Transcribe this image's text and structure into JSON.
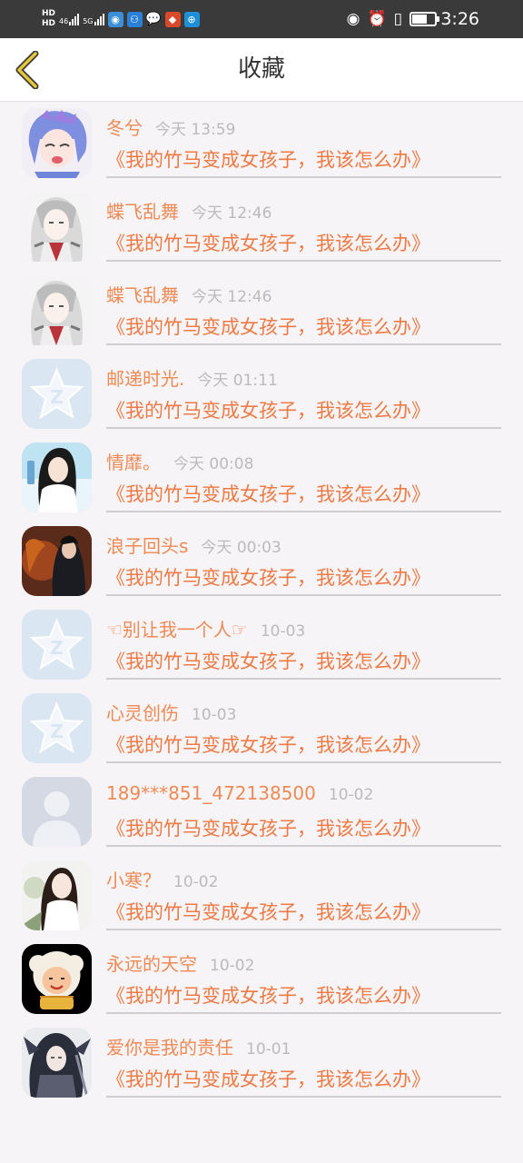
{
  "status_bar": {
    "hd1": "HD",
    "hd2": "HD",
    "net1": "46",
    "net2": "5G",
    "time": "3:26"
  },
  "header": {
    "title": "收藏"
  },
  "colors": {
    "accent": "#ee7a45",
    "name": "#ee8a55",
    "timestamp": "#bbbbbb",
    "back_arrow": "#e6c73a"
  },
  "favorites": [
    {
      "name": "冬兮",
      "time": "今天 13:59",
      "book": "《我的竹马变成女孩子，我该怎么办》",
      "avatar": "anime-blue-hair"
    },
    {
      "name": "蝶飞乱舞",
      "time": "今天 12:46",
      "book": "《我的竹马变成女孩子，我该怎么办》",
      "avatar": "anime-white-hair"
    },
    {
      "name": "蝶飞乱舞",
      "time": "今天 12:46",
      "book": "《我的竹马变成女孩子，我该怎么办》",
      "avatar": "anime-white-hair"
    },
    {
      "name": "邮递时光.",
      "time": "今天 01:11",
      "book": "《我的竹马变成女孩子，我该怎么办》",
      "avatar": "qzone-default"
    },
    {
      "name": "情靡。",
      "time": "今天 00:08",
      "book": "《我的竹马变成女孩子，我该怎么办》",
      "avatar": "girl-photo"
    },
    {
      "name": "浪子回头s",
      "time": "今天 00:03",
      "book": "《我的竹马变成女孩子，我该怎么办》",
      "avatar": "dark-figure"
    },
    {
      "name": "☜别让我一个人☞",
      "time": "10-03",
      "book": "《我的竹马变成女孩子，我该怎么办》",
      "avatar": "qzone-default"
    },
    {
      "name": "心灵创伤",
      "time": "10-03",
      "book": "《我的竹马变成女孩子，我该怎么办》",
      "avatar": "qzone-default"
    },
    {
      "name": "189***851_472138500",
      "time": "10-02",
      "book": "《我的竹马变成女孩子，我该怎么办》",
      "avatar": "default-person"
    },
    {
      "name": "小寒？",
      "time": "10-02",
      "book": "《我的竹马变成女孩子，我该怎么办》",
      "avatar": "girl-white"
    },
    {
      "name": "永远的天空",
      "time": "10-02",
      "book": "《我的竹马变成女孩子，我该怎么办》",
      "avatar": "cartoon-sheep"
    },
    {
      "name": "爱你是我的责任",
      "time": "10-01",
      "book": "《我的竹马变成女孩子，我该怎么办》",
      "avatar": "anime-dark-warrior"
    }
  ]
}
